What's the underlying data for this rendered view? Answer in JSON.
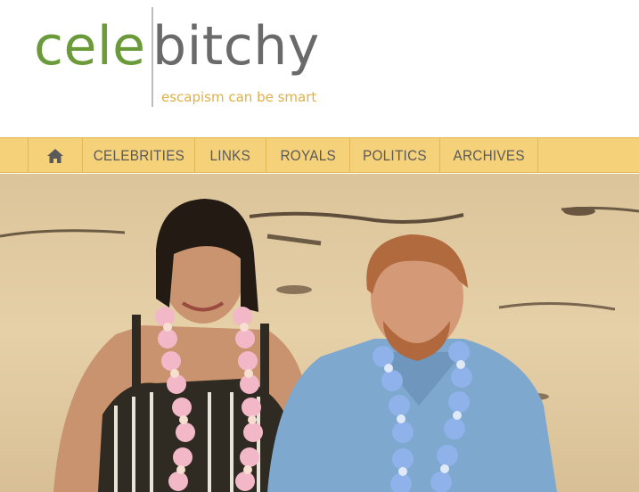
{
  "logo": {
    "part1": "cele",
    "part2": "bitchy",
    "tagline": "escapism can be smart"
  },
  "nav": {
    "home_icon": "home-icon",
    "items": [
      {
        "label": "CELEBRITIES"
      },
      {
        "label": "LINKS"
      },
      {
        "label": "ROYALS"
      },
      {
        "label": "POLITICS"
      },
      {
        "label": "ARCHIVES"
      }
    ]
  },
  "colors": {
    "nav_bg": "#f5d27a",
    "logo_green": "#6a9a3a",
    "logo_gray": "#6a6a6a",
    "tagline": "#e0b046"
  }
}
